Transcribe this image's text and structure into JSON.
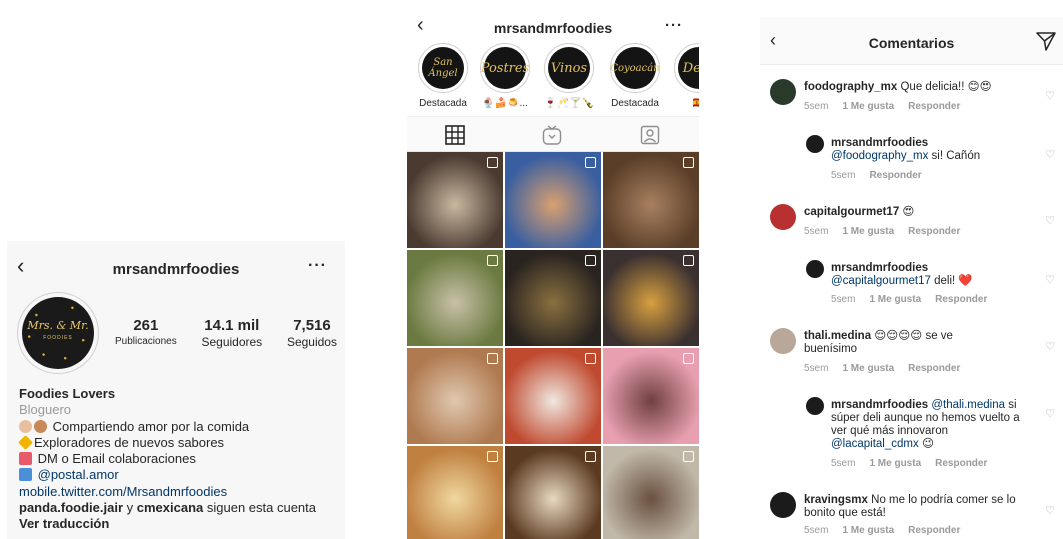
{
  "profile": {
    "username": "mrsandmrfoodies",
    "avatar_text_top": "Mrs. & Mr.",
    "avatar_text_bottom": "FOODIES",
    "stats": [
      {
        "value": "261",
        "label": "Publicaciones"
      },
      {
        "value": "14.1 mil",
        "label": "Seguidores"
      },
      {
        "value": "7,516",
        "label": "Seguidos"
      }
    ],
    "display_name": "Foodies Lovers",
    "category": "Bloguero",
    "bio_lines": [
      "Compartiendo amor por la comida",
      "Exploradores de nuevos sabores",
      "DM o Email colaboraciones"
    ],
    "mention": "@postal.amor",
    "website": "mobile.twitter.com/Mrsandmrfoodies",
    "followed_by_1": "panda.foodie.jair",
    "followed_by_conj": " y ",
    "followed_by_2": "cmexicana",
    "followed_by_suffix": " siguen esta cuenta",
    "translate": "Ver traducción"
  },
  "grid_view": {
    "username": "mrsandmrfoodies",
    "highlights": [
      {
        "cover": "San Ángel",
        "label": "Destacada"
      },
      {
        "cover": "Postres",
        "label": "🍨🍰🍮..."
      },
      {
        "cover": "Vinos",
        "label": "🍷🥂🍸🍾"
      },
      {
        "cover": "Coyoacán",
        "label": "Destacada"
      },
      {
        "cover": "Desa",
        "label": "🇪🇸"
      }
    ],
    "tabs": [
      "grid-icon",
      "igtv-icon",
      "tagged-icon"
    ],
    "photo_colors": [
      [
        "#4a3a30",
        "#c9b8a0"
      ],
      [
        "#3a5fa0",
        "#d9a070"
      ],
      [
        "#5a3e28",
        "#a88060"
      ],
      [
        "#6a7a40",
        "#c9c0a8"
      ],
      [
        "#2a2420",
        "#8a7040"
      ],
      [
        "#3a3030",
        "#d8a040"
      ],
      [
        "#b07a50",
        "#e0c8b0"
      ],
      [
        "#c04a30",
        "#f0e8e0"
      ],
      [
        "#e8a0b0",
        "#704040"
      ],
      [
        "#c08040",
        "#f0d8a0"
      ],
      [
        "#5a3a20",
        "#e8d8c0"
      ],
      [
        "#c0b8a8",
        "#6a5040"
      ]
    ]
  },
  "comments_view": {
    "title": "Comentarios",
    "comments": [
      {
        "user": "foodography_mx",
        "text": " Que delicia!! 😊😍",
        "time": "5sem",
        "likes": "1 Me gusta",
        "reply": "Responder",
        "nested": false
      },
      {
        "user": "mrsandmrfoodies",
        "mention": "@foodography_mx",
        "text": " si! Cañón",
        "time": "5sem",
        "likes": "",
        "reply": "Responder",
        "nested": true
      },
      {
        "user": "capitalgourmet17",
        "text": " 😍",
        "time": "5sem",
        "likes": "1 Me gusta",
        "reply": "Responder",
        "nested": false
      },
      {
        "user": "mrsandmrfoodies",
        "mention": "@capitalgourmet17",
        "text": " deli! ❤️",
        "time": "5sem",
        "likes": "1 Me gusta",
        "reply": "Responder",
        "nested": true
      },
      {
        "user": "thali.medina",
        "text": " 😌😌😌😌 se ve buenísimo",
        "time": "5sem",
        "likes": "1 Me gusta",
        "reply": "Responder",
        "nested": false
      },
      {
        "user": "mrsandmrfoodies",
        "mention": "@thali.medina",
        "text": " si súper deli aunque no hemos vuelto a ver qué más innovaron ",
        "mention2": "@lacapital_cdmx",
        "text2": " 😉",
        "time": "5sem",
        "likes": "1 Me gusta",
        "reply": "Responder",
        "nested": true
      },
      {
        "user": "kravingsmx",
        "text": " No me lo podría comer se lo bonito que está!",
        "time": "5sem",
        "likes": "1 Me gusta",
        "reply": "Responder",
        "nested": false
      }
    ]
  }
}
